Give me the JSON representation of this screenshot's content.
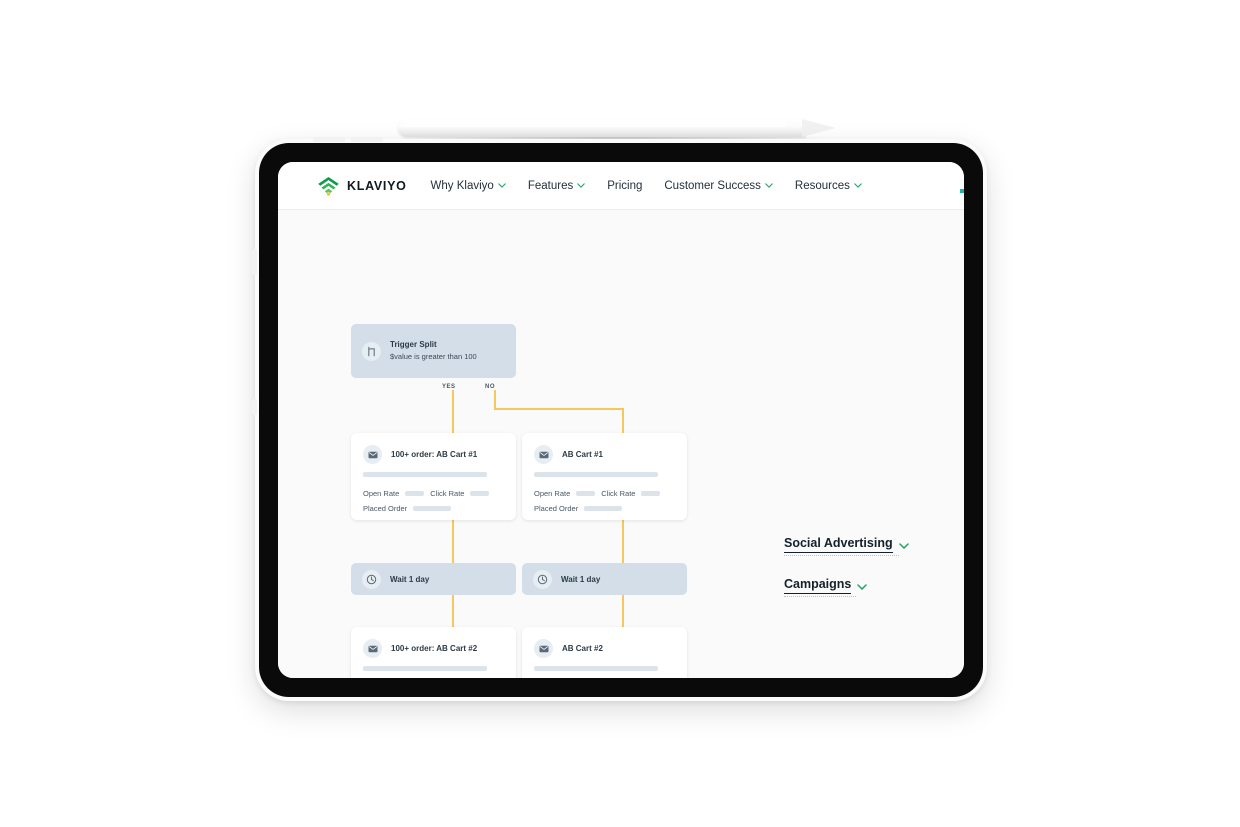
{
  "device": {
    "type": "tablet",
    "accessory": "stylus"
  },
  "nav": {
    "brand": "KLAVIYO",
    "brand_icon": "klaviyo-arc-logo",
    "links": [
      {
        "label": "Why Klaviyo",
        "has_chevron": true
      },
      {
        "label": "Features",
        "has_chevron": true
      },
      {
        "label": "Pricing",
        "has_chevron": false
      },
      {
        "label": "Customer Success",
        "has_chevron": true
      },
      {
        "label": "Resources",
        "has_chevron": true
      }
    ]
  },
  "flow": {
    "split": {
      "icon": "split-branch-icon",
      "title": "Trigger Split",
      "condition": "$value is greater than 100"
    },
    "branch_labels": {
      "yes": "YES",
      "no": "NO"
    },
    "metric_labels": {
      "open_rate": "Open Rate",
      "click_rate": "Click Rate",
      "placed_order": "Placed Order"
    },
    "cards": [
      {
        "icon": "envelope-icon",
        "title": "100+ order: AB Cart #1",
        "column": "yes"
      },
      {
        "icon": "envelope-icon",
        "title": "AB Cart #1",
        "column": "no"
      },
      {
        "icon": "envelope-icon",
        "title": "100+ order: AB Cart #2",
        "column": "yes"
      },
      {
        "icon": "envelope-icon",
        "title": "AB Cart #2",
        "column": "no"
      }
    ],
    "waits": [
      {
        "icon": "clock-icon",
        "title": "Wait 1 day",
        "column": "yes"
      },
      {
        "icon": "clock-icon",
        "title": "Wait 1 day",
        "column": "no"
      }
    ]
  },
  "side_links": [
    {
      "label": "Social Advertising",
      "has_chevron": true
    },
    {
      "label": "Campaigns",
      "has_chevron": true
    }
  ],
  "colors": {
    "connector": "#f5c75e",
    "node_fill": "#d3dee8",
    "skeleton": "#dde3ea",
    "accent_green": "#1a9e4b",
    "chevron_green": "#1fa463",
    "page_bg": "#fafafa"
  }
}
